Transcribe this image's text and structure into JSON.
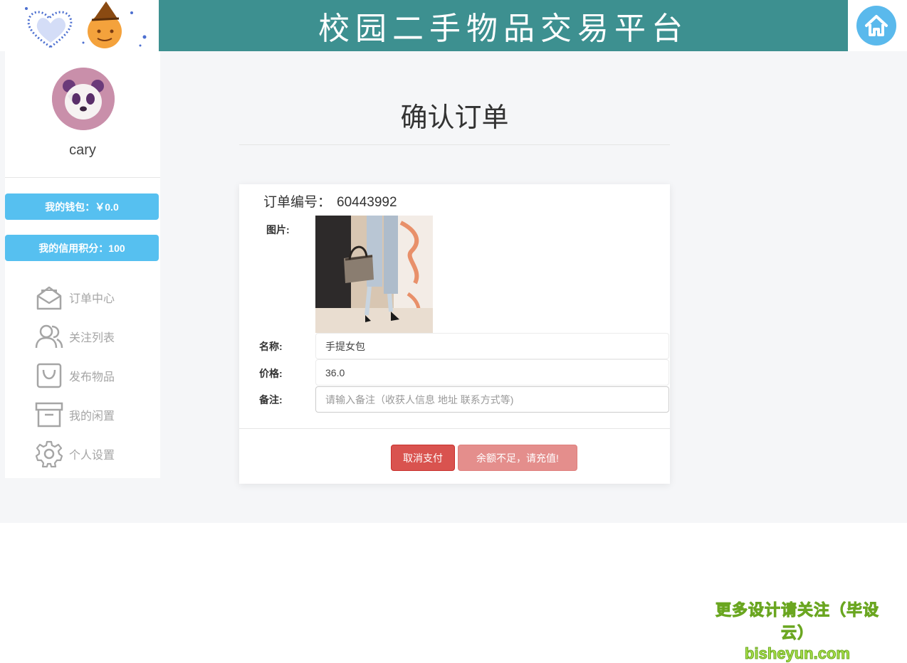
{
  "header": {
    "banner_title": "校园二手物品交易平台",
    "icons": {
      "decoration": "heart-pumpkin-decoration",
      "home": "home-icon"
    },
    "colors": {
      "banner": "#3d9090",
      "home_button": "#5ab9ec"
    }
  },
  "sidebar": {
    "username": "cary",
    "avatar_icon": "panda-avatar",
    "wallet_label": "我的钱包：￥0.0",
    "credit_label": "我的信用积分：100",
    "pill_color": "#56c0f0",
    "menu": [
      {
        "label": "订单中心",
        "icon": "envelope-open-icon"
      },
      {
        "label": "关注列表",
        "icon": "users-icon"
      },
      {
        "label": "发布物品",
        "icon": "shopping-bag-icon"
      },
      {
        "label": "我的闲置",
        "icon": "archive-box-icon"
      },
      {
        "label": "个人设置",
        "icon": "gear-icon"
      }
    ]
  },
  "main": {
    "title": "确认订单",
    "order": {
      "number_label": "订单编号：",
      "number": "60443992",
      "image_label": "图片:",
      "name_label": "名称:",
      "name": "手提女包",
      "price_label": "价格:",
      "price": "36.0",
      "note_label": "备注:",
      "note_placeholder": "请输入备注（收获人信息 地址 联系方式等)",
      "note_value": ""
    },
    "buttons": {
      "cancel": "取消支付",
      "pay": "余额不足，请充值!"
    },
    "colors": {
      "cancel": "#d9534f",
      "pay": "#e48e8c"
    }
  },
  "watermark": {
    "line1": "更多设计请关注（毕设云）",
    "line2": "bisheyun.com"
  }
}
